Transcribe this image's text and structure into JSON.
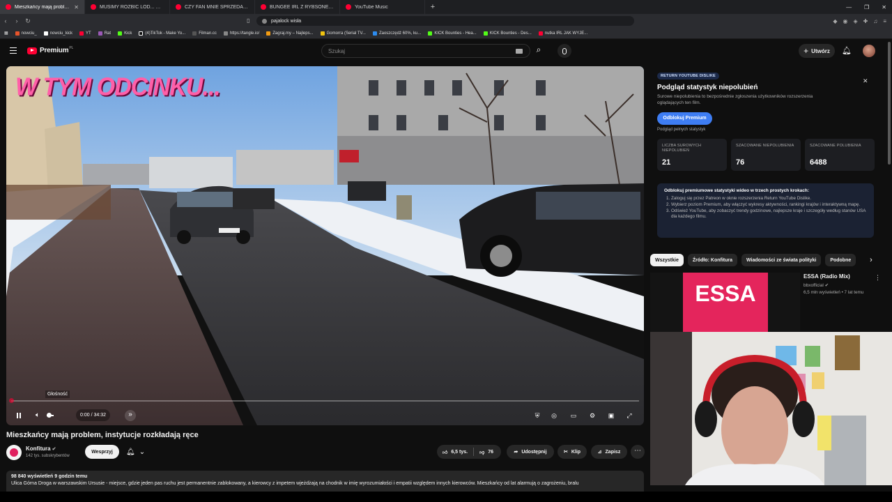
{
  "browser": {
    "tabs": [
      {
        "label": "Mieszkańcy mają problem, in",
        "active": true
      },
      {
        "label": "MUSIMY ROZBIĆ LÓD... Szukam wyż",
        "active": false
      },
      {
        "label": "CZY FAN MNIE SPRZEDA? *prank pol",
        "active": false
      },
      {
        "label": "BUNGEE IRL Z RYBSONEM I MEDUSI",
        "active": false
      },
      {
        "label": "YouTube Music",
        "active": false
      }
    ],
    "url": "pajalock wisła",
    "bookmarks": [
      "nowciu_",
      "nowciu_kick",
      "YT",
      "Rat",
      "Kick",
      "(4)TikTok - Make Yo...",
      "Filman.cc",
      "https://tangle.io/",
      "Zagraj.my – Najleps...",
      "Gomorra (Serial TV...",
      "Zaoszczędź 60%, ku...",
      "KICK Bounties - Hea...",
      "KICK Bounties - Des...",
      "nutka IRL JAK WYJE..."
    ]
  },
  "header": {
    "brand": "Premium",
    "brand_region": "PL",
    "search_placeholder": "Szukaj",
    "create_label": "Utwórz"
  },
  "player": {
    "overlay_text": "W TYM ODCINKU...",
    "tooltip": "Głośność",
    "time": "0:00 / 34:32",
    "progress": 0.0
  },
  "video": {
    "title": "Mieszkańcy mają problem, instytucje rozkładają ręce",
    "channel": "Konfitura",
    "subscribers": "142 tys. subskrybentów",
    "support_label": "Wesprzyj",
    "likes": "6,5 tys.",
    "dislikes": "76",
    "share_label": "Udostępnij",
    "clip_label": "Klip",
    "save_label": "Zapisz",
    "views_meta": "98 840 wyświetleń  9 godzin temu",
    "description": "Ulica Górna Droga w warszawskim Ursusie - miejsce, gdzie jeden pas ruchu jest permanentnie zablokowany, a kierowcy z impetem wjeżdżają na chodnik w imię wyrozumiałości i empatii względem innych kierowców. Mieszkańcy od lat alarmują o zagrożeniu, bralu"
  },
  "ryd": {
    "badge": "RETURN YOUTUBE DISLIKE",
    "title": "Podgląd statystyk niepolubień",
    "subtitle": "Surowe niepolubienia to bezpośrednie zgłoszenia użytkowników rozszerzenia oglądających ten film.",
    "unlock_label": "Odblokuj Premium",
    "full_stats": "Podgląd pełnych statystyk",
    "stats": [
      {
        "label": "LICZBA SUROWYCH NIEPOLUBIEŃ",
        "value": "21"
      },
      {
        "label": "SZACOWANE NIEPOLUBIENIA",
        "value": "76"
      },
      {
        "label": "SZACOWANE POLUBIENIA",
        "value": "6488"
      }
    ],
    "steps_title": "Odblokuj premiumowe statystyki wideo w trzech prostych krokach:",
    "steps": [
      "Zaloguj się przez Patreon w oknie rozszerzenia Return YouTube Dislike.",
      "Wybierz poziom Premium, aby włączyć wykresy aktywności, rankingi krajów i interaktywną mapę.",
      "Odśwież YouTube, aby zobaczyć trendy godzinowe, najlepsze kraje i szczegóły według stanów USA dla każdego filmu."
    ]
  },
  "chips": [
    "Wszystkie",
    "Źródło: Konfitura",
    "Wiadomości ze świata polityki",
    "Podobne"
  ],
  "recommendation": {
    "thumb_text": "ESSA",
    "title": "ESSA (Radio Mix)",
    "channel": "bbxofficial",
    "meta": "6,5 mln wyświetleń • 7 lat temu"
  },
  "colors": {
    "brand_red": "#ff0033",
    "accent_blue": "#3e7df3",
    "overlay_pink": "#ff5fa8"
  }
}
